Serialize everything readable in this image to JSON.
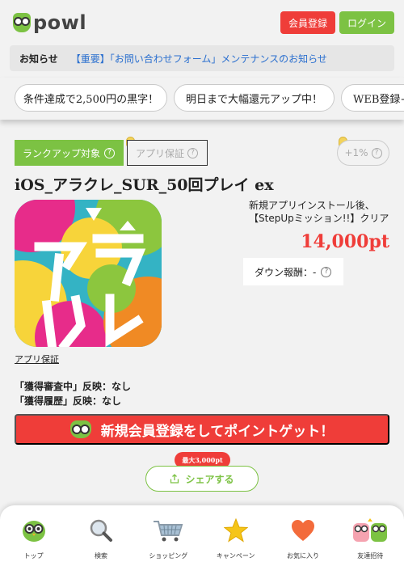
{
  "header": {
    "logo_text": "powl",
    "register_label": "会員登録",
    "login_label": "ログイン"
  },
  "notice": {
    "label": "お知らせ",
    "link_text": "【重要】「お問い合わせフォーム」メンテナンスのお知らせ"
  },
  "promo_chips": [
    "条件達成で2,500円の黒字！",
    "明日まで大幅還元アップ中！",
    "WEB登録+"
  ],
  "offer": {
    "rank_tag": "ランクアップ対象",
    "guarantee_tag": "アプリ保証",
    "plus_tag": "+1%",
    "title": "iOS_アラクレ_SUR_50回プレイ ex",
    "description": "新規アプリインストール後、【StepUpミッション!!】クリア",
    "points": "14,000pt",
    "down_reward": "ダウン報酬：-",
    "app_guarantee_link": "アプリ保証",
    "status_lines": [
      "「獲得審査中」反映：なし",
      "「獲得履歴」反映：なし"
    ],
    "cta_label": "新規会員登録をしてポイントゲット！",
    "bubble_text": "最大3,000pt",
    "share_label": "シェアする"
  },
  "colors": {
    "brand_green": "#7cc243",
    "accent_red": "#ef3d39",
    "link_blue": "#2a6fcf"
  },
  "bottom_nav": [
    {
      "label": "トップ",
      "icon": "owl-icon"
    },
    {
      "label": "検索",
      "icon": "search-icon"
    },
    {
      "label": "ショッピング",
      "icon": "cart-icon"
    },
    {
      "label": "キャンペーン",
      "icon": "star-icon"
    },
    {
      "label": "お気に入り",
      "icon": "heart-icon"
    },
    {
      "label": "友達招待",
      "icon": "friends-icon"
    }
  ]
}
